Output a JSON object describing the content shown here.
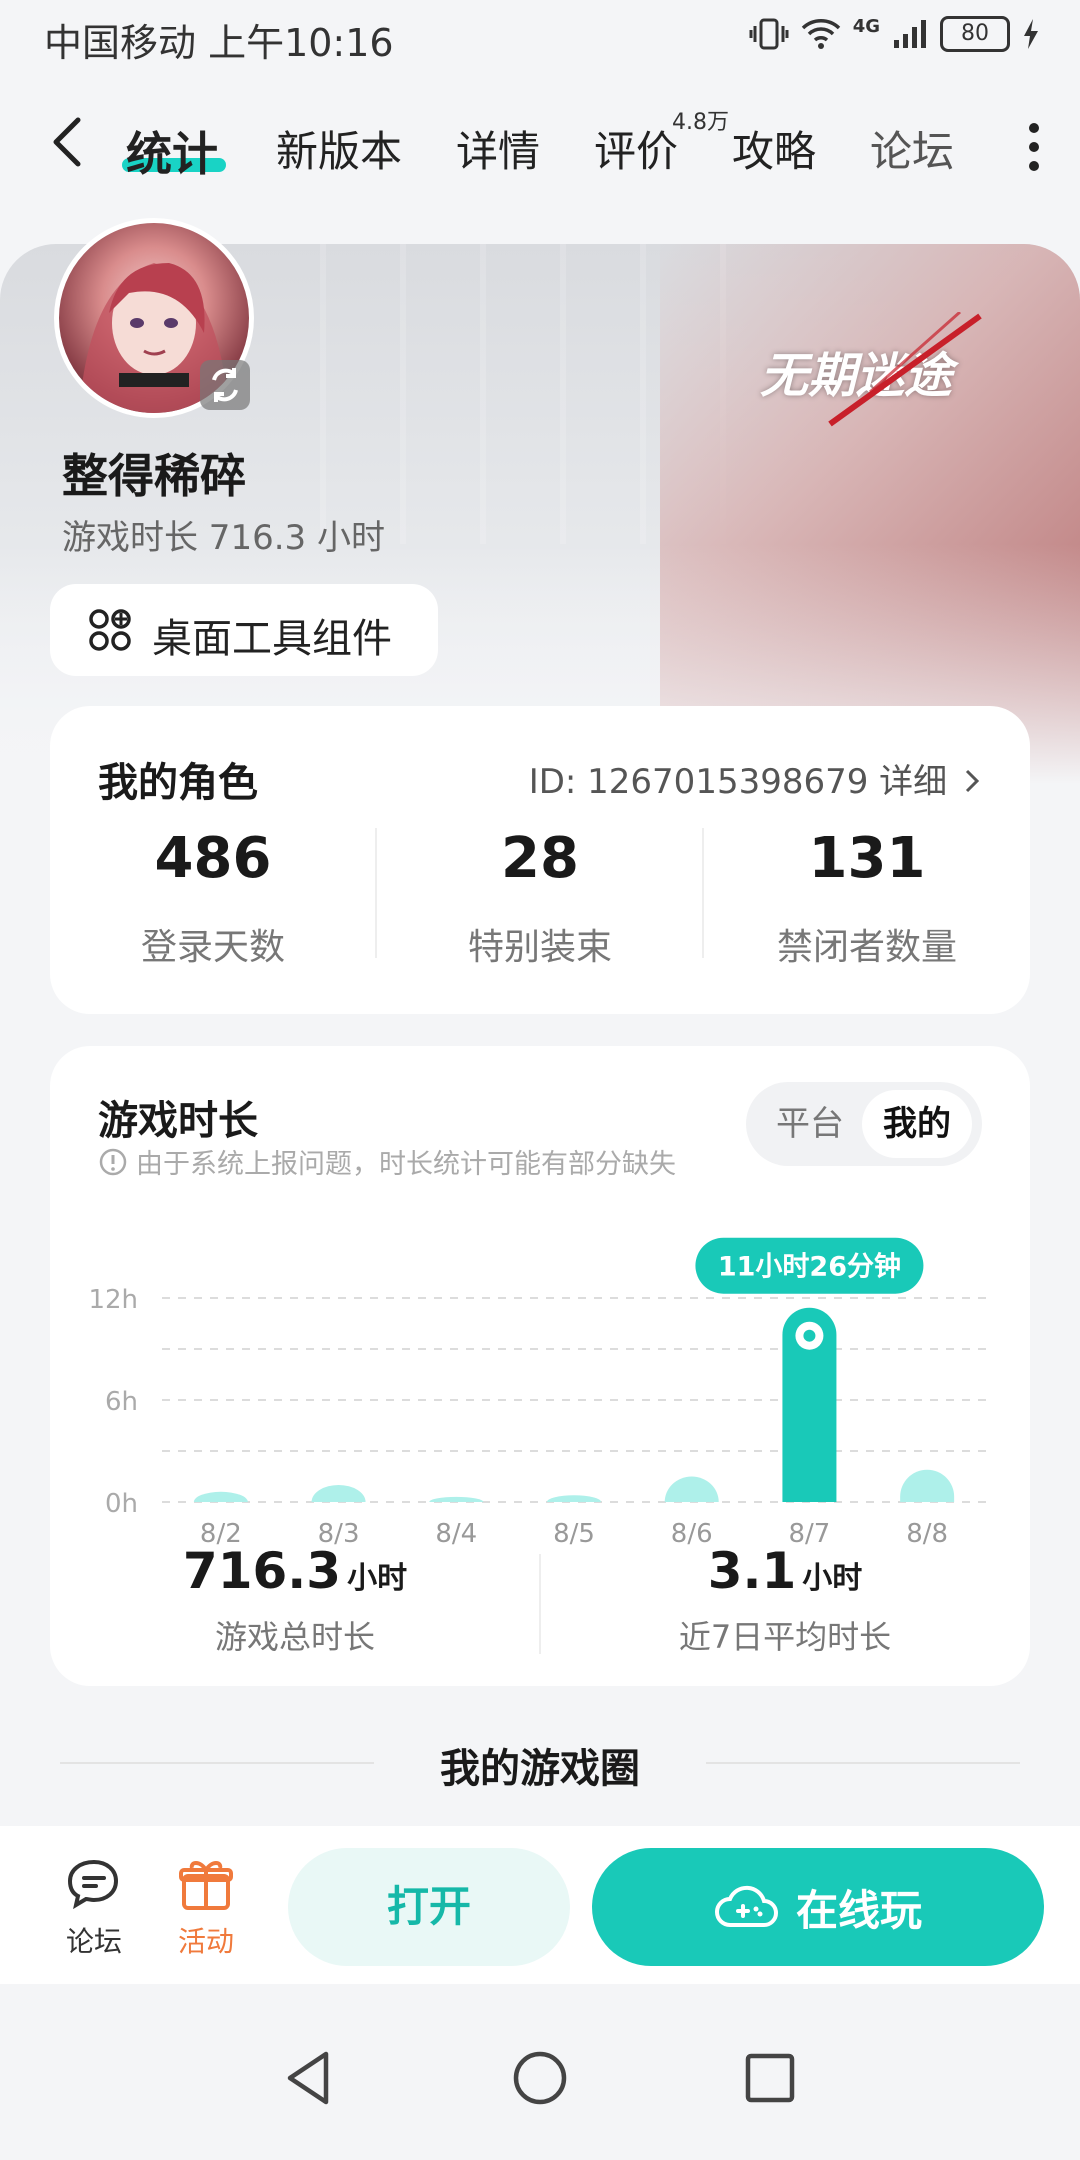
{
  "status_bar": {
    "carrier_time": "中国移动 上午10:16",
    "network": "4G",
    "battery": "80"
  },
  "nav": {
    "tabs": [
      {
        "label": "统计",
        "active": true
      },
      {
        "label": "新版本"
      },
      {
        "label": "详情"
      },
      {
        "label": "评价",
        "badge": "4.8万"
      },
      {
        "label": "攻略"
      },
      {
        "label": "论坛"
      }
    ]
  },
  "profile": {
    "game_logo_text": "无期迷途",
    "username": "整得稀碎",
    "playtime": "游戏时长 716.3 小时",
    "widget_button": "桌面工具组件"
  },
  "role_card": {
    "title": "我的角色",
    "id_text": "ID: 1267015398679 详细",
    "stats": [
      {
        "value": "486",
        "label": "登录天数"
      },
      {
        "value": "28",
        "label": "特别装束"
      },
      {
        "value": "131",
        "label": "禁闭者数量"
      }
    ]
  },
  "playtime_card": {
    "title": "游戏时长",
    "toggle": {
      "options": [
        "平台",
        "我的"
      ],
      "selected": "我的"
    },
    "notice": "由于系统上报问题，时长统计可能有部分缺失",
    "highlight_tooltip": "11小时26分钟",
    "summary": [
      {
        "value": "716.3",
        "unit": "小时",
        "label": "游戏总时长"
      },
      {
        "value": "3.1",
        "unit": "小时",
        "label": "近7日平均时长"
      }
    ]
  },
  "chart_data": {
    "type": "bar",
    "categories": [
      "8/2",
      "8/3",
      "8/4",
      "8/5",
      "8/6",
      "8/7",
      "8/8"
    ],
    "values": [
      0.6,
      1.0,
      0.3,
      0.4,
      1.5,
      11.43,
      1.9
    ],
    "highlight_index": 5,
    "ylim": [
      0,
      12
    ],
    "yticks": [
      "12h",
      "6h",
      "0h"
    ],
    "grid": true,
    "colors": {
      "bar": "#aef0ea",
      "highlight": "#19c9b8"
    }
  },
  "section": {
    "title": "我的游戏圈"
  },
  "bottom_bar": {
    "forum_label": "论坛",
    "activity_label": "活动",
    "open_label": "打开",
    "play_label": "在线玩"
  },
  "colors": {
    "accent": "#19c9b8",
    "activity": "#f07a3c"
  }
}
